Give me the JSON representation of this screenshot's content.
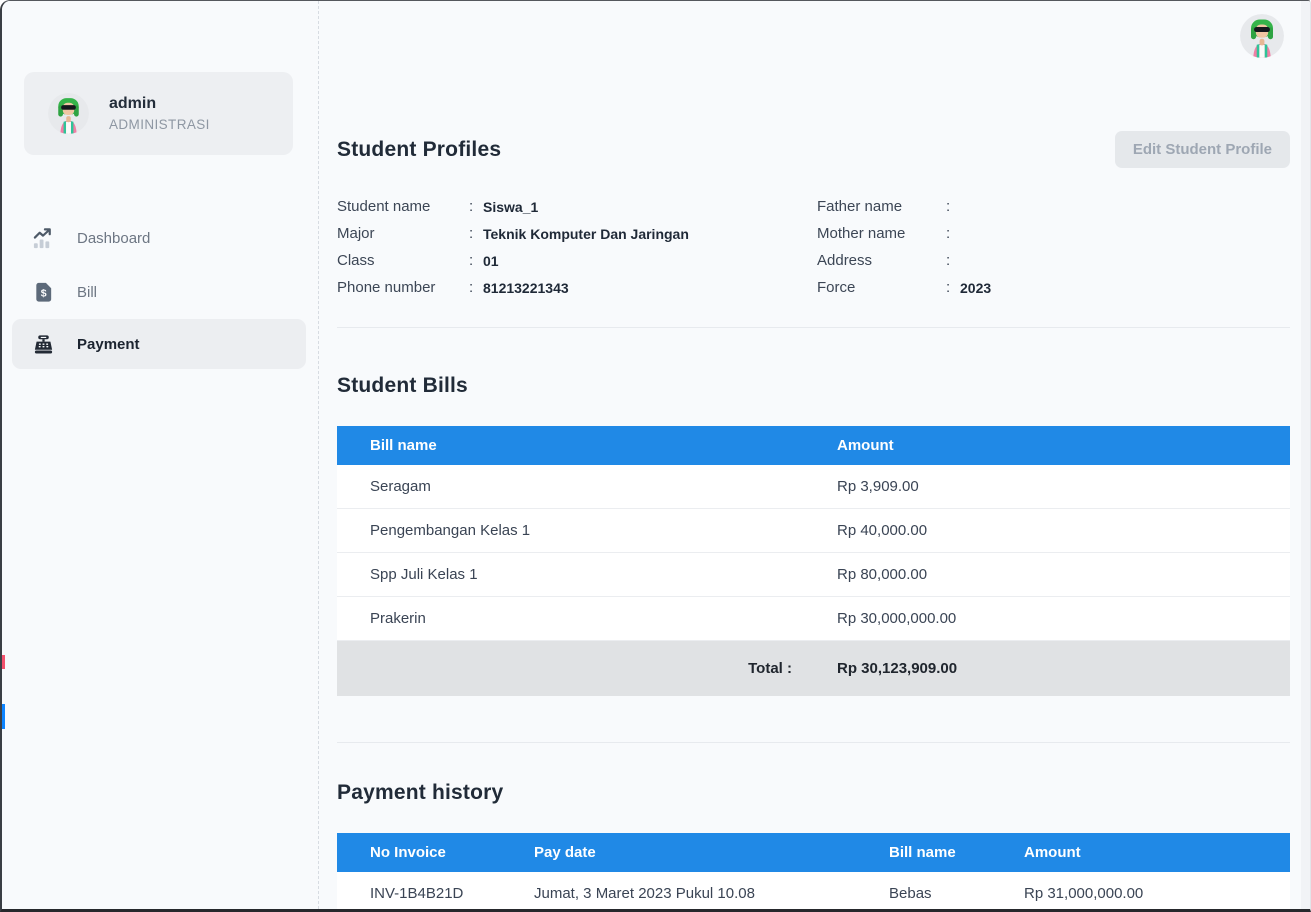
{
  "sidebar": {
    "profile": {
      "name": "admin",
      "role": "ADMINISTRASI"
    },
    "items": [
      {
        "label": "Dashboard",
        "icon": "chart-trending-up-icon",
        "active": false
      },
      {
        "label": "Bill",
        "icon": "bill-document-icon",
        "active": false
      },
      {
        "label": "Payment",
        "icon": "cash-register-icon",
        "active": true
      }
    ]
  },
  "profile_section": {
    "title": "Student Profiles",
    "edit_button_label": "Edit Student Profile",
    "colon": ":",
    "fields_left": [
      {
        "label": "Student name",
        "value": "Siswa_1"
      },
      {
        "label": "Major",
        "value": "Teknik Komputer Dan Jaringan"
      },
      {
        "label": "Class",
        "value": "01"
      },
      {
        "label": "Phone number",
        "value": "81213221343"
      }
    ],
    "fields_right": [
      {
        "label": "Father name",
        "value": ""
      },
      {
        "label": "Mother name",
        "value": ""
      },
      {
        "label": "Address",
        "value": ""
      },
      {
        "label": "Force",
        "value": "2023"
      }
    ]
  },
  "bills_section": {
    "title": "Student Bills",
    "columns": [
      "Bill name",
      "Amount"
    ],
    "rows": [
      {
        "name": "Seragam",
        "amount": "Rp 3,909.00"
      },
      {
        "name": "Pengembangan Kelas 1",
        "amount": "Rp 40,000.00"
      },
      {
        "name": "Spp Juli Kelas 1",
        "amount": "Rp 80,000.00"
      },
      {
        "name": "Prakerin",
        "amount": "Rp 30,000,000.00"
      }
    ],
    "total_label": "Total :",
    "total_value": "Rp 30,123,909.00"
  },
  "history_section": {
    "title": "Payment history",
    "columns": [
      "No Invoice",
      "Pay date",
      "Bill name",
      "Amount"
    ],
    "rows": [
      {
        "invoice": "INV-1B4B21D",
        "pay_date": "Jumat, 3 Maret 2023 Pukul 10.08",
        "bill_name": "Bebas",
        "amount": "Rp 31,000,000.00"
      }
    ]
  },
  "colors": {
    "accent_blue": "#2089E6",
    "background": "#F8FAFC",
    "card_gray": "#EDEFF2",
    "total_row_gray": "#E0E2E4",
    "edge_marker_red": "#F4516C",
    "edge_marker_blue": "#0D84FF"
  }
}
